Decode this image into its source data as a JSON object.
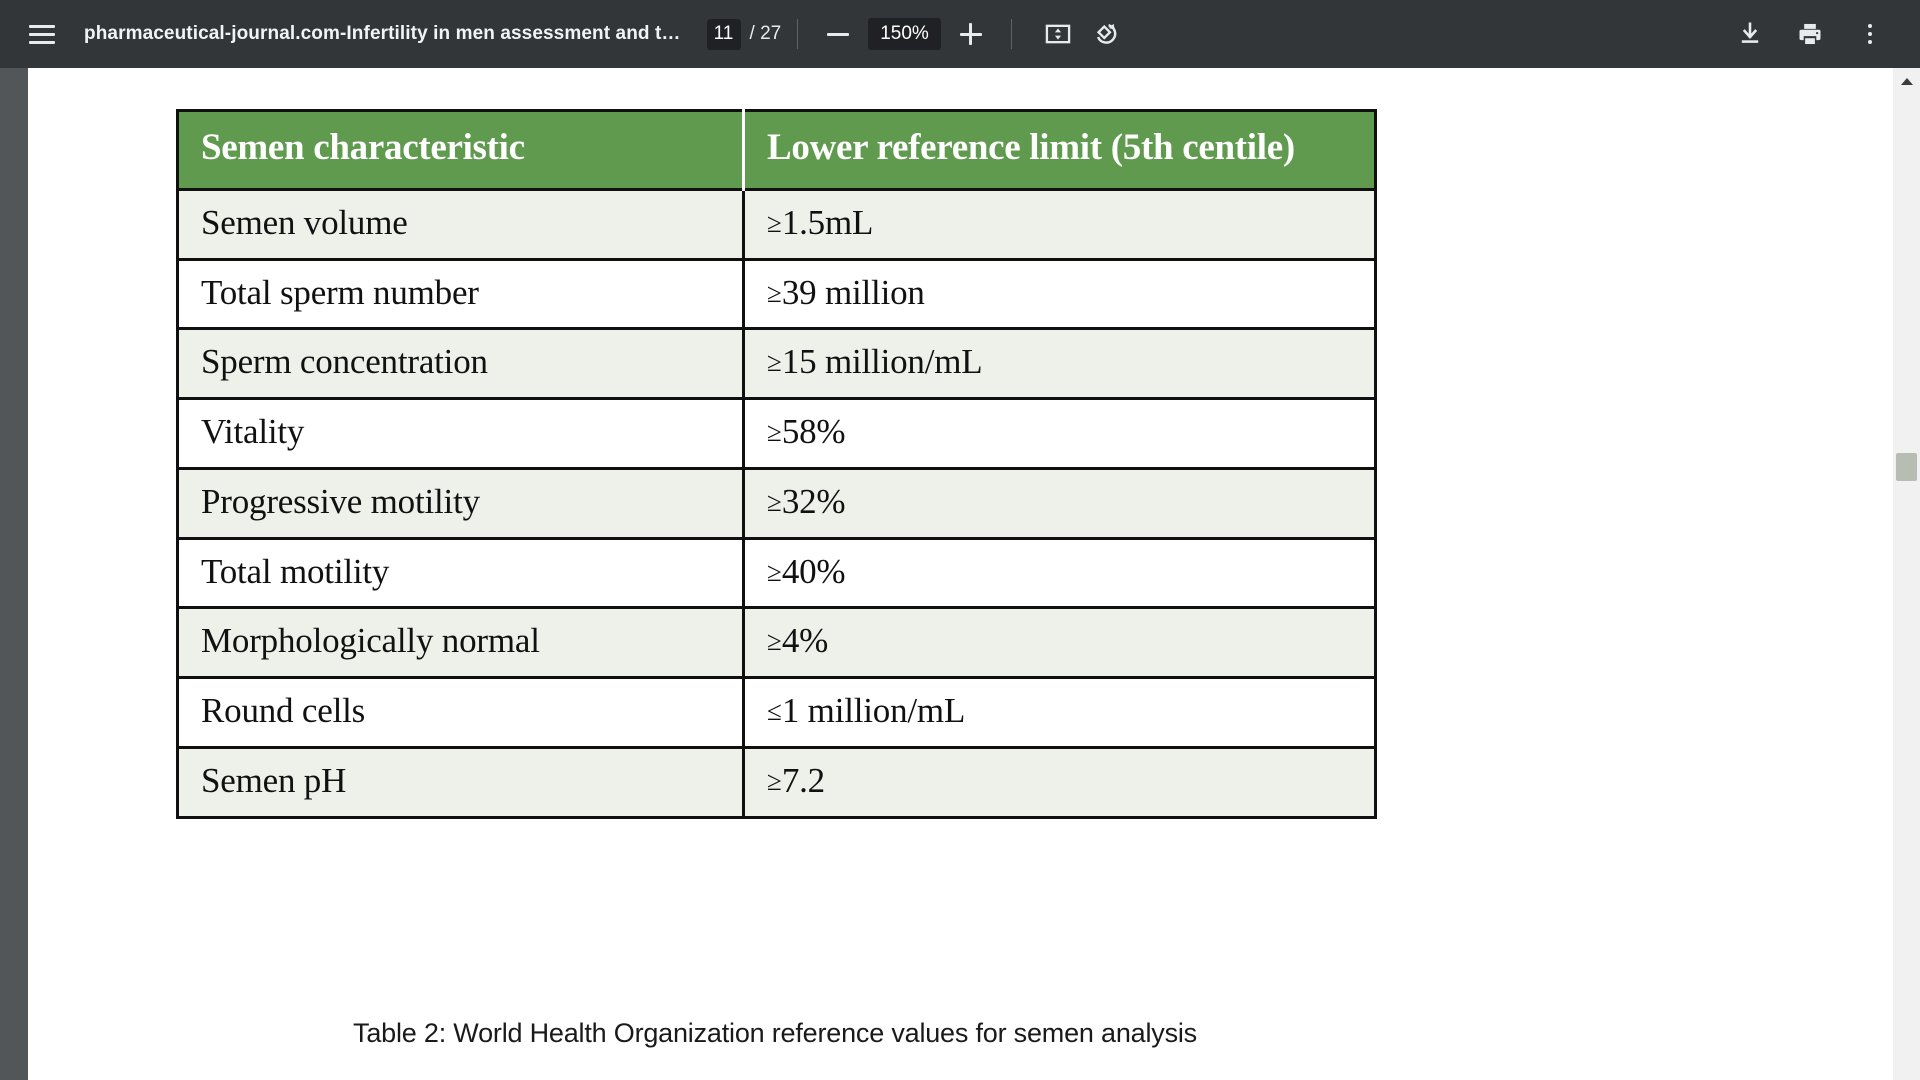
{
  "toolbar": {
    "menu_icon": "hamburger-menu-icon",
    "document_title": "pharmaceutical-journal.com-Infertility in men assessment and t…",
    "page_current": "11",
    "page_total": "/ 27",
    "zoom_out_icon": "minus-icon",
    "zoom_level": "150%",
    "zoom_in_icon": "plus-icon",
    "fit_page_icon": "fit-to-page-icon",
    "rotate_icon": "rotate-counterclockwise-icon",
    "download_icon": "download-icon",
    "print_icon": "print-icon",
    "more_icon": "more-options-kebab-icon"
  },
  "table": {
    "headers": [
      "Semen characteristic",
      "Lower reference limit (5th centile)"
    ],
    "rows": [
      {
        "characteristic": "Semen volume",
        "cmp": "≥",
        "limit": "1.5mL"
      },
      {
        "characteristic": "Total sperm number",
        "cmp": "≥",
        "limit": "39 million"
      },
      {
        "characteristic": "Sperm concentration",
        "cmp": "≥",
        "limit": "15 million/mL"
      },
      {
        "characteristic": "Vitality",
        "cmp": "≥",
        "limit": "58%"
      },
      {
        "characteristic": "Progressive motility",
        "cmp": "≥",
        "limit": "32%"
      },
      {
        "characteristic": "Total motility",
        "cmp": "≥",
        "limit": "40%"
      },
      {
        "characteristic": "Morphologically normal",
        "cmp": "≥",
        "limit": "4%"
      },
      {
        "characteristic": "Round cells",
        "cmp": "≤",
        "limit": "1 million/mL"
      },
      {
        "characteristic": "Semen pH",
        "cmp": "≥",
        "limit": "7.2"
      }
    ],
    "caption": "Table 2: World Health Organization reference values for semen analysis"
  },
  "colors": {
    "toolbar_bg": "#323639",
    "viewer_bg": "#525659",
    "header_green": "#5f9a4e",
    "row_alt": "#eef0ea",
    "row_plain": "#ffffff",
    "border": "#101010"
  }
}
